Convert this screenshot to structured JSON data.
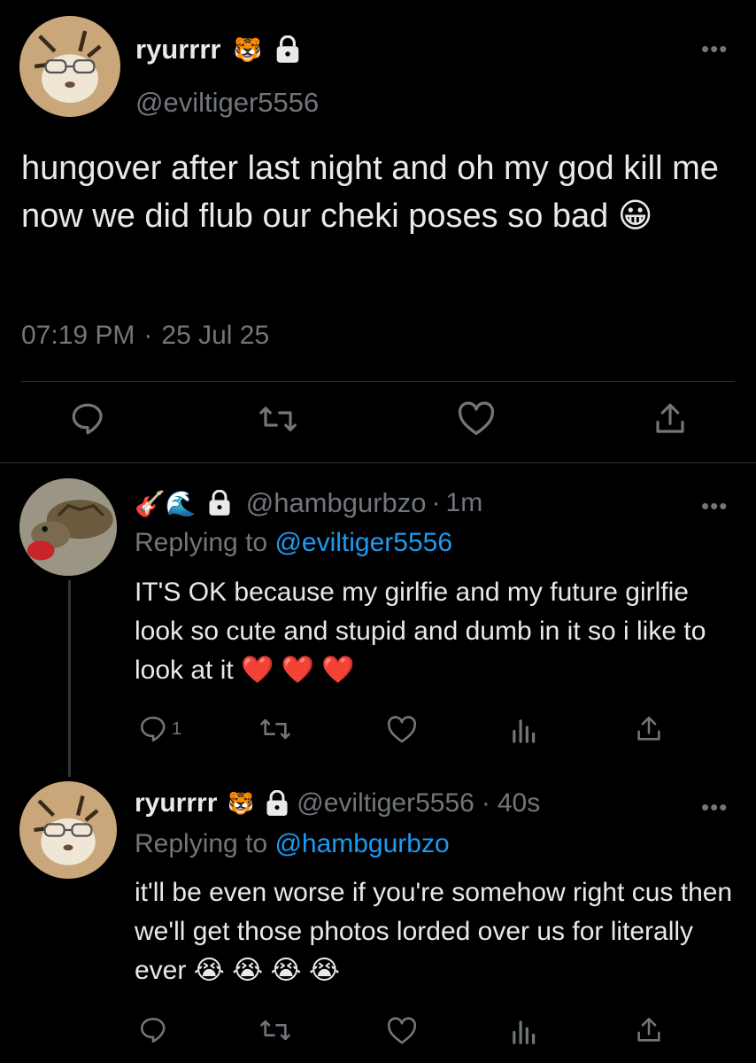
{
  "main_tweet": {
    "display_name": "ryurrrr",
    "emoji": "🐯",
    "handle": "@eviltiger5556",
    "text": "hungover after last night and oh my god kill me now we did flub our cheki poses so bad 😀",
    "time": "07:19 PM",
    "separator": "·",
    "date": "25 Jul 25",
    "more": "•••"
  },
  "reply1": {
    "emojis": "🎸🌊",
    "handle": "@hambgurbzo",
    "separator": "·",
    "time": "1m",
    "replying_prefix": "Replying to",
    "replying_handle": "@eviltiger5556",
    "text": "IT'S OK because my girlfie and my future girlfie look so cute and stupid and dumb in it so i like to look at it ❤️ ❤️ ❤️",
    "reply_count": "1",
    "more": "•••"
  },
  "reply2": {
    "display_name": "ryurrrr",
    "emoji": "🐯",
    "handle": "@eviltiger5556",
    "separator": "·",
    "time": "40s",
    "replying_prefix": "Replying to",
    "replying_handle": "@hambgurbzo",
    "text": "it'll be even worse if you're somehow right cus then we'll get those photos lorded over us for literally ever 😭 😭 😭 😭",
    "more": "•••"
  },
  "colors": {
    "background": "#000000",
    "text": "#e7e9ea",
    "muted": "#71767b",
    "link": "#1d9bf0",
    "divider": "#2f3336"
  },
  "icons": [
    "reply-icon",
    "retweet-icon",
    "like-icon",
    "share-icon",
    "analytics-icon",
    "lock-icon",
    "more-icon"
  ]
}
